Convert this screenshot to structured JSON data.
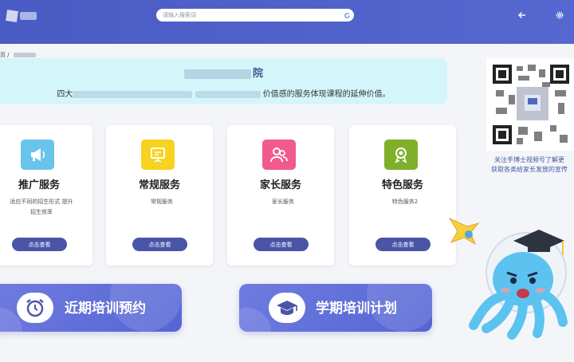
{
  "header": {
    "search_placeholder": "请输入搜索词"
  },
  "breadcrumb": {
    "home": "页",
    "separator": "/"
  },
  "banner": {
    "title_suffix": "院",
    "desc_start": "四大",
    "desc_end": "价值感的服务体现课程的延伸价值。"
  },
  "cards": [
    {
      "title": "推广服务",
      "desc": "适应不同的招生形式 提升招生效率",
      "button": "点击查看",
      "color": "#69c3ea"
    },
    {
      "title": "常规服务",
      "desc": "常规服务",
      "button": "点击查看",
      "color": "#f7d31f"
    },
    {
      "title": "家长服务",
      "desc": "家长服务",
      "button": "点击查看",
      "color": "#f05b8c"
    },
    {
      "title": "特色服务",
      "desc": "特色服务2",
      "button": "点击查看",
      "color": "#7fb029"
    }
  ],
  "big_buttons": [
    {
      "label": "近期培训预约",
      "icon": "alarm-clock-icon"
    },
    {
      "label": "学期培训计划",
      "icon": "graduation-cap-icon"
    }
  ],
  "qr_caption": {
    "line1": "关注手博士视频号了解更",
    "line2": "获取各类给家长发放的宣传"
  },
  "colors": {
    "header": "#5060c9",
    "banner_bg": "#d4f6fb",
    "card_button": "#4a55a8",
    "accent_text": "#3a5ca0"
  }
}
